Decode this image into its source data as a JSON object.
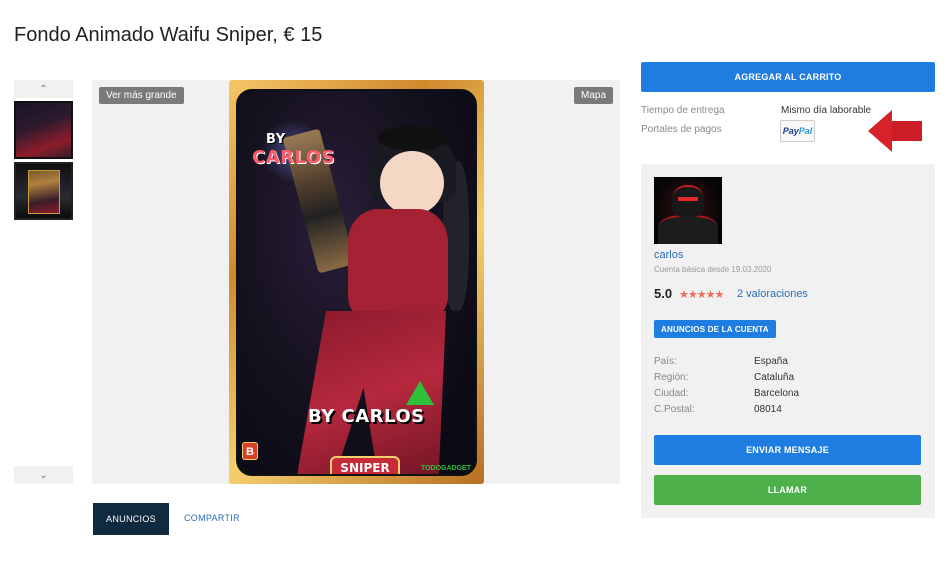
{
  "listing": {
    "title": "Fondo Animado Waifu Sniper, € 15"
  },
  "gallery": {
    "up_arrow": "⌃",
    "down_arrow": "⌄",
    "view_larger_label": "Ver más grande",
    "map_label": "Mapa",
    "card_text_top_line1": "BY",
    "card_text_top_line2": "CARLOS",
    "card_text_bottom": "BY CARLOS",
    "card_tag": "SNIPER",
    "card_badge": "B",
    "card_watermark": "TODOGADGET"
  },
  "tabs": {
    "ads_label": "ANUNCIOS",
    "share_label": "COMPARTIR"
  },
  "purchase": {
    "add_to_cart_label": "AGREGAR AL CARRITO",
    "delivery_label": "Tiempo de entrega",
    "delivery_value": "Mismo día laborable",
    "payment_label": "Portales de pagos",
    "payment_logo_pay": "Pay",
    "payment_logo_pal": "Pal"
  },
  "seller": {
    "name": "carlos",
    "since": "Cuenta básica desde 19.03.2020",
    "rating": "5.0",
    "stars": "★★★★★",
    "reviews": "2 valoraciones",
    "account_ads_label": "ANUNCIOS DE LA CUENTA",
    "details": [
      {
        "label": "País:",
        "value": "España"
      },
      {
        "label": "Región:",
        "value": "Cataluña"
      },
      {
        "label": "Ciudad:",
        "value": "Barcelona"
      },
      {
        "label": "C.Postal:",
        "value": "08014"
      }
    ],
    "message_label": "ENVIAR MENSAJE",
    "call_label": "LLAMAR"
  },
  "colors": {
    "primary_blue": "#1f7ce0",
    "call_green": "#4db04a",
    "tab_dark": "#102a40",
    "link_blue": "#2a6fb5",
    "star_red": "#ef6b5a",
    "arrow_red": "#d8222a"
  }
}
